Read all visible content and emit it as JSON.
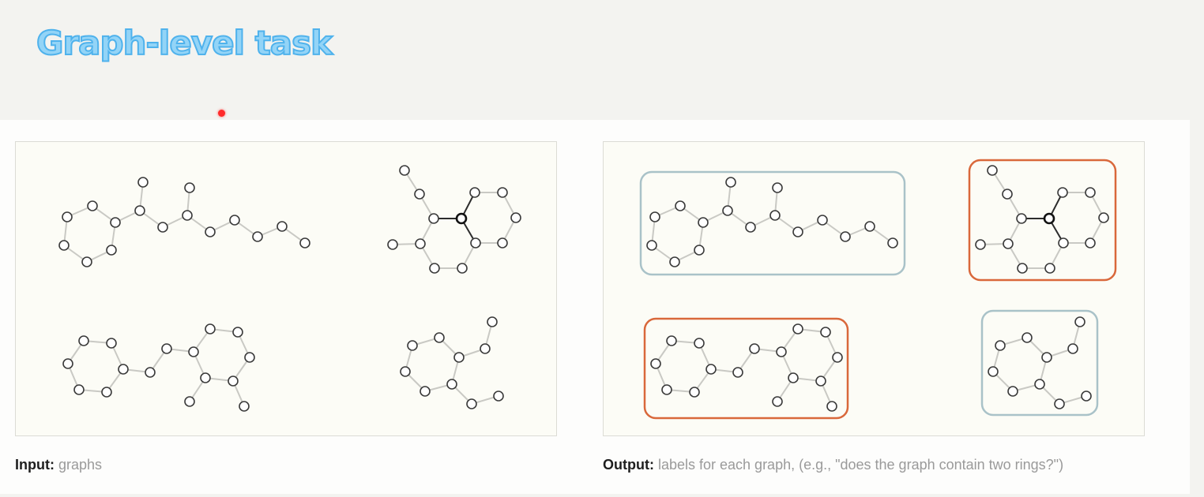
{
  "title": "Graph-level task",
  "input_caption": {
    "label": "Input:",
    "text": "graphs"
  },
  "output_caption": {
    "label": "Output:",
    "text": "labels for each graph, (e.g., \"does the graph contain two rings?\")"
  },
  "colors": {
    "title": "#93d4f7",
    "title_outline": "#4fb2ec",
    "label_box_blue": "#a9c2c8",
    "label_box_orange": "#d9683b",
    "laser_pointer": "#ff2a2a"
  },
  "graph_labels": [
    {
      "graph": "graph-1",
      "label": "one ring",
      "box_color": "blue"
    },
    {
      "graph": "graph-2",
      "label": "two rings",
      "box_color": "orange"
    },
    {
      "graph": "graph-3",
      "label": "two rings",
      "box_color": "orange"
    },
    {
      "graph": "graph-4",
      "label": "one ring",
      "box_color": "blue"
    }
  ]
}
